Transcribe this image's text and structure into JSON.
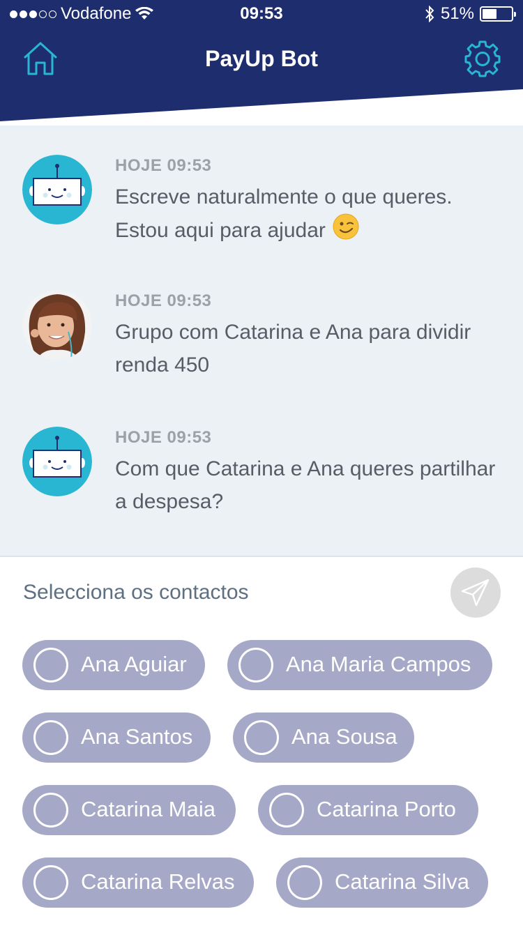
{
  "status_bar": {
    "carrier": "Vodafone",
    "signal_bars_filled": 3,
    "signal_bars_total": 5,
    "time": "09:53",
    "battery_percent": "51%",
    "battery_level": 0.51
  },
  "header": {
    "title": "PayUp Bot",
    "home_icon": "home-icon",
    "settings_icon": "gear-icon",
    "colors": {
      "background": "#1e2d6e",
      "icon_accent": "#29b6d2"
    }
  },
  "chat": {
    "messages": [
      {
        "sender": "bot",
        "time": "HOJE 09:53",
        "text": "Escreve naturalmente o que queres. Estou aqui para ajudar",
        "emoji": "winking-face"
      },
      {
        "sender": "user",
        "time": "HOJE 09:53",
        "text": "Grupo com Catarina e Ana para dividir renda 450"
      },
      {
        "sender": "bot",
        "time": "HOJE 09:53",
        "text": "Com que Catarina e Ana queres partilhar a despesa?"
      }
    ]
  },
  "contacts_panel": {
    "prompt": "Selecciona os contactos",
    "send_icon": "paper-plane-icon",
    "contacts": [
      {
        "name": "Ana Aguiar",
        "selected": false
      },
      {
        "name": "Ana Maria Campos",
        "selected": false
      },
      {
        "name": "Ana Santos",
        "selected": false
      },
      {
        "name": "Ana Sousa",
        "selected": false
      },
      {
        "name": "Catarina Maia",
        "selected": false
      },
      {
        "name": "Catarina Porto",
        "selected": false
      },
      {
        "name": "Catarina Relvas",
        "selected": false
      },
      {
        "name": "Catarina Silva",
        "selected": false
      }
    ]
  }
}
